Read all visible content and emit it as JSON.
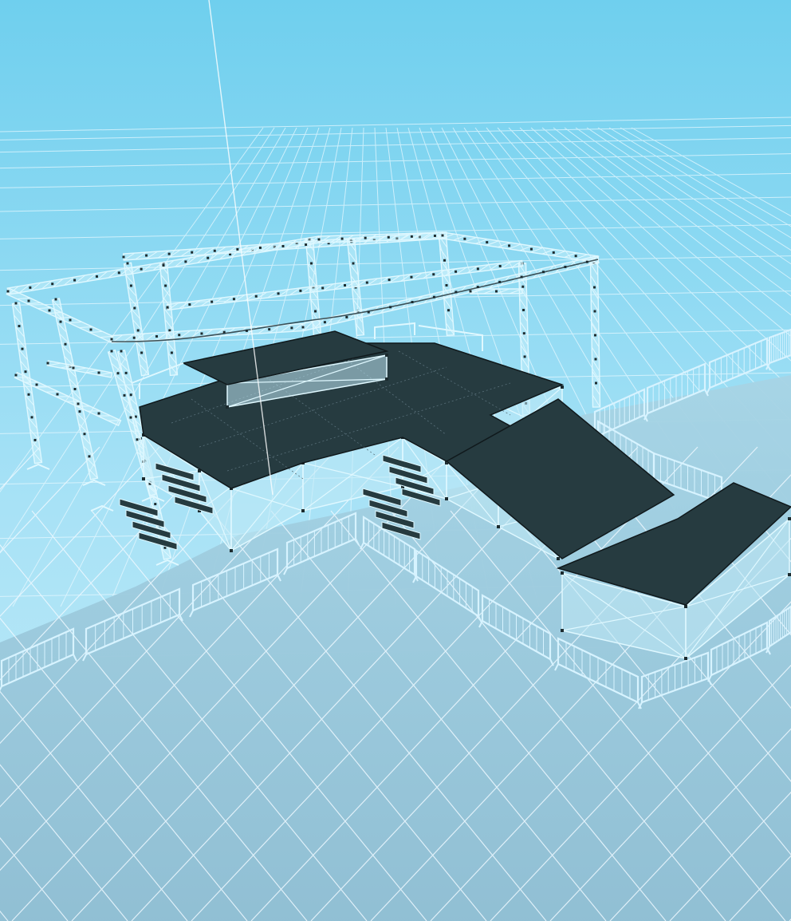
{
  "scene": {
    "name": "3d-stage-truss-viewport",
    "colors": {
      "sky_top": "#6ccdee",
      "sky_bottom": "#bde9f8",
      "ground": "#98c8dc",
      "ground_grid": "#eaf7ff",
      "horizon_grid": "#d9f3fd",
      "deck": "#263b40",
      "deck_edge": "#10191c",
      "truss": "#dff8ff",
      "truss_dark": "#1c2b2f",
      "barrier": "#d7f3ff"
    },
    "objects": [
      "truss-roof-frame",
      "main-stage-deck",
      "upper-riser-deck",
      "catwalk-deck",
      "thrust-stage-deck",
      "stage-stairs",
      "crowd-barriers",
      "ground-plane-grid"
    ]
  }
}
